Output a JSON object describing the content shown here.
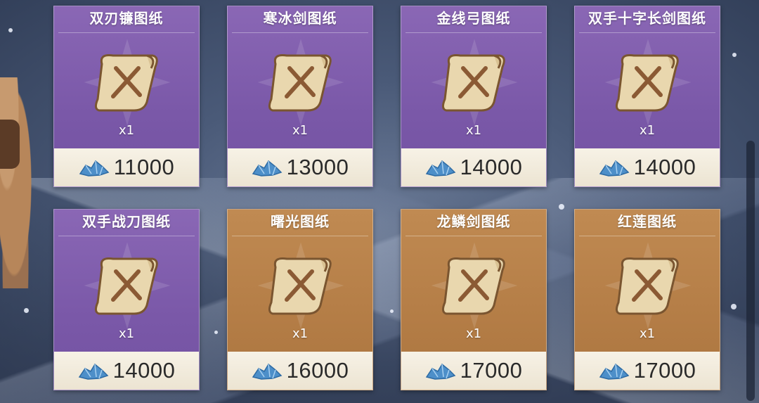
{
  "shop": {
    "items": [
      {
        "name": "双刃镰图纸",
        "qty": "x1",
        "price": "11000",
        "rarity": "purple",
        "icon": "blueprint-scroll-icon"
      },
      {
        "name": "寒冰剑图纸",
        "qty": "x1",
        "price": "13000",
        "rarity": "purple",
        "icon": "blueprint-scroll-icon"
      },
      {
        "name": "金线弓图纸",
        "qty": "x1",
        "price": "14000",
        "rarity": "purple",
        "icon": "blueprint-scroll-icon"
      },
      {
        "name": "双手十字长剑图纸",
        "qty": "x1",
        "price": "14000",
        "rarity": "purple",
        "icon": "blueprint-scroll-icon"
      },
      {
        "name": "双手战刀图纸",
        "qty": "x1",
        "price": "14000",
        "rarity": "purple",
        "icon": "blueprint-scroll-icon"
      },
      {
        "name": "曙光图纸",
        "qty": "x1",
        "price": "16000",
        "rarity": "gold",
        "icon": "blueprint-scroll-icon"
      },
      {
        "name": "龙鳞剑图纸",
        "qty": "x1",
        "price": "17000",
        "rarity": "gold",
        "icon": "blueprint-scroll-icon"
      },
      {
        "name": "红莲图纸",
        "qty": "x1",
        "price": "17000",
        "rarity": "gold",
        "icon": "blueprint-scroll-icon"
      }
    ],
    "currency_icon": "blue-crystal-icon",
    "colors": {
      "purple": "#7a58a8",
      "gold": "#b47d46",
      "price_bar": "#f3ede0"
    }
  }
}
